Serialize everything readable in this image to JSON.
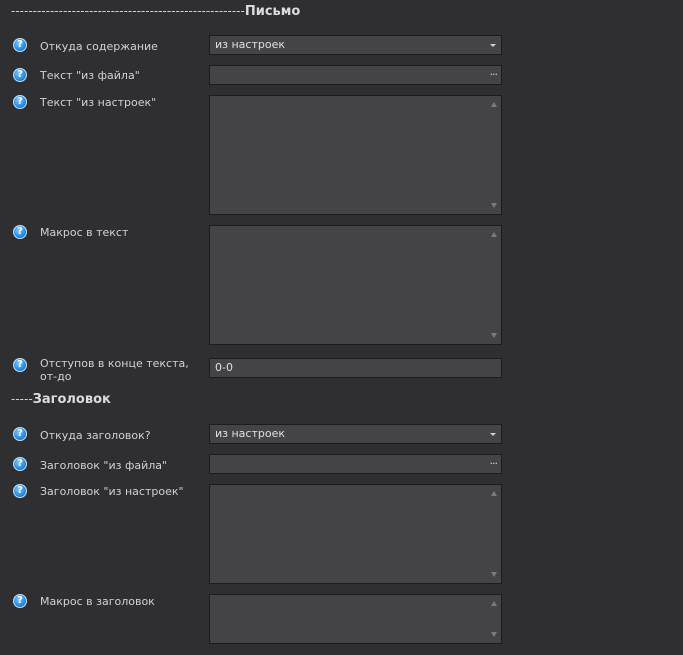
{
  "section_letter": {
    "dashes": "------------------------------------------------------",
    "title": "Письмо"
  },
  "section_header": {
    "dashes": "-----",
    "title": "Заголовок"
  },
  "help_glyph": "?",
  "fields": {
    "content_source": {
      "label": "Откуда содержание",
      "value": "из настроек"
    },
    "text_from_file": {
      "label": "Текст \"из файла\"",
      "value": ""
    },
    "text_from_settings": {
      "label": "Текст \"из настроек\"",
      "value": ""
    },
    "macro_text": {
      "label": "Макрос в текст",
      "value": ""
    },
    "indents": {
      "label": "Отступов в конце текста, от-до",
      "value": "0-0"
    },
    "header_source": {
      "label": "Откуда заголовок?",
      "value": "из настроек"
    },
    "header_from_file": {
      "label": "Заголовок \"из файла\"",
      "value": ""
    },
    "header_from_settings": {
      "label": "Заголовок \"из настроек\"",
      "value": ""
    },
    "macro_header": {
      "label": "Макрос в заголовок",
      "value": ""
    }
  },
  "browse_glyph": "···",
  "icons": {
    "help": "help-circle-icon",
    "dropdown": "chevron-down-icon",
    "browse": "ellipsis-icon"
  }
}
